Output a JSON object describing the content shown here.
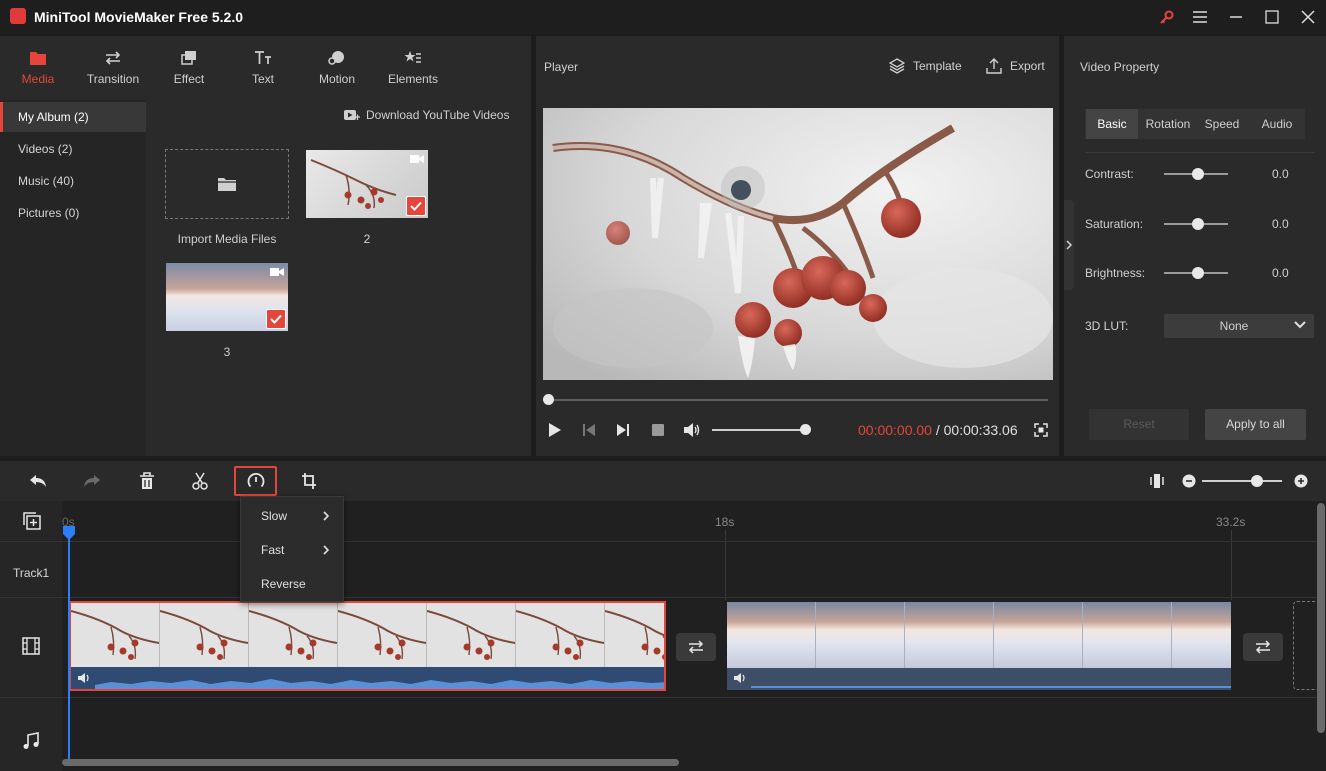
{
  "app": {
    "title": "MiniTool MovieMaker Free 5.2.0"
  },
  "toolbar_tabs": [
    {
      "label": "Media",
      "icon": "folder-icon",
      "active": true
    },
    {
      "label": "Transition",
      "icon": "transition-icon"
    },
    {
      "label": "Effect",
      "icon": "effect-icon"
    },
    {
      "label": "Text",
      "icon": "text-icon"
    },
    {
      "label": "Motion",
      "icon": "motion-icon"
    },
    {
      "label": "Elements",
      "icon": "elements-icon"
    }
  ],
  "media": {
    "categories": [
      "My Album (2)",
      "Videos (2)",
      "Music (40)",
      "Pictures (0)"
    ],
    "download_label": "Download YouTube Videos",
    "import_label": "Import Media Files",
    "items": [
      {
        "caption": "2"
      },
      {
        "caption": "3"
      }
    ]
  },
  "player": {
    "title": "Player",
    "template_label": "Template",
    "export_label": "Export",
    "current_time": "00:00:00.00",
    "separator": " / ",
    "total_time": "00:00:33.06",
    "progress": 0,
    "volume": 1.0
  },
  "properties": {
    "title": "Video Property",
    "tabs": [
      "Basic",
      "Rotation",
      "Speed",
      "Audio"
    ],
    "active_tab": "Basic",
    "contrast_label": "Contrast:",
    "contrast_value": "0.0",
    "saturation_label": "Saturation:",
    "saturation_value": "0.0",
    "brightness_label": "Brightness:",
    "brightness_value": "0.0",
    "lut_label": "3D LUT:",
    "lut_value": "None",
    "reset_label": "Reset",
    "apply_label": "Apply to all"
  },
  "timeline": {
    "ruler": [
      "0s",
      "18s",
      "33.2s"
    ],
    "track1_label": "Track1",
    "speed_menu": [
      {
        "label": "Slow",
        "submenu": true
      },
      {
        "label": "Fast",
        "submenu": true
      },
      {
        "label": "Reverse",
        "submenu": false
      }
    ],
    "zoom": 0.8
  },
  "colors": {
    "accent": "#e4463b",
    "playhead": "#2d7ff9",
    "bg": "#1c1c1c"
  }
}
